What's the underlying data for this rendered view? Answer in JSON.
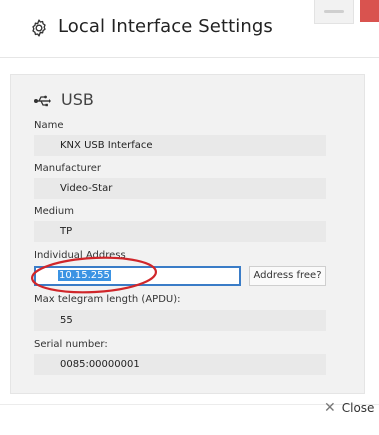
{
  "dialog": {
    "title": "Local Interface Settings",
    "close_label": "Close",
    "close_glyph": "✕"
  },
  "icons": {
    "settings": "gear-icon",
    "usb": "usb-icon"
  },
  "usb": {
    "section_title": "USB",
    "name_label": "Name",
    "name_value": "KNX USB Interface",
    "manufacturer_label": "Manufacturer",
    "manufacturer_value": "Video-Star",
    "medium_label": "Medium",
    "medium_value": "TP",
    "address_label": "Individual Address",
    "address_value": "10.15.255",
    "address_button": "Address free?",
    "apdu_label": "Max telegram length (APDU):",
    "apdu_value": "55",
    "serial_label": "Serial number:",
    "serial_value": "0085:00000001"
  },
  "colors": {
    "annotation": "#d0262a",
    "input_border": "#3a7cc7",
    "selection": "#3b93e3",
    "close_control": "#d9534f"
  }
}
